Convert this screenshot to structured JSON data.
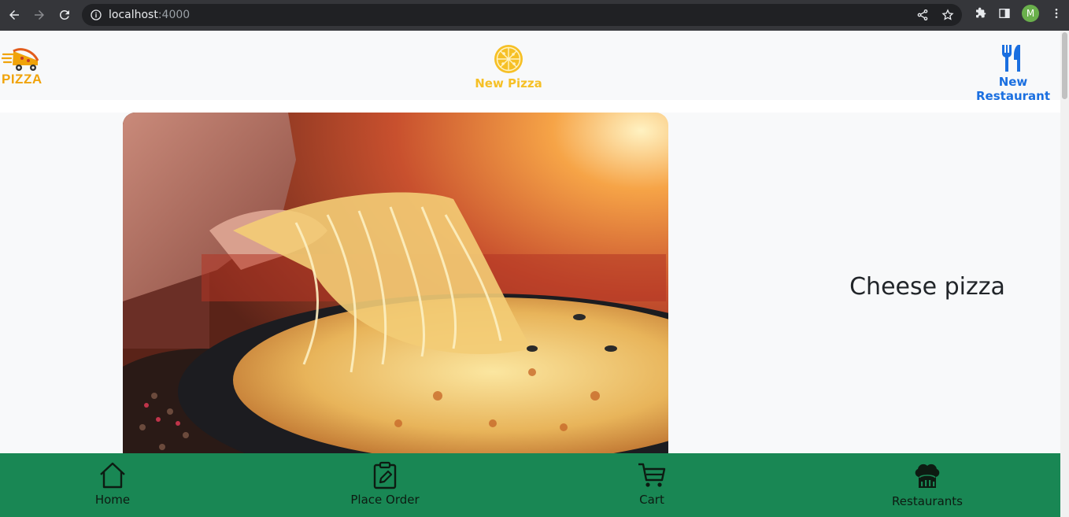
{
  "browser": {
    "url_host": "localhost",
    "url_port": ":4000",
    "avatar_letter": "M"
  },
  "header": {
    "brand_text": "PIZZA",
    "new_pizza_label": "New Pizza",
    "new_restaurant_label": "New Restaurant"
  },
  "main": {
    "title": "Cheese pizza"
  },
  "bottom_nav": {
    "home": "Home",
    "place_order": "Place Order",
    "cart": "Cart",
    "restaurants": "Restaurants"
  },
  "colors": {
    "brand_orange": "#f0a30a",
    "new_pizza_yellow": "#f6c026",
    "new_restaurant_blue": "#1a6fe0",
    "bottom_nav_green": "#198754"
  }
}
